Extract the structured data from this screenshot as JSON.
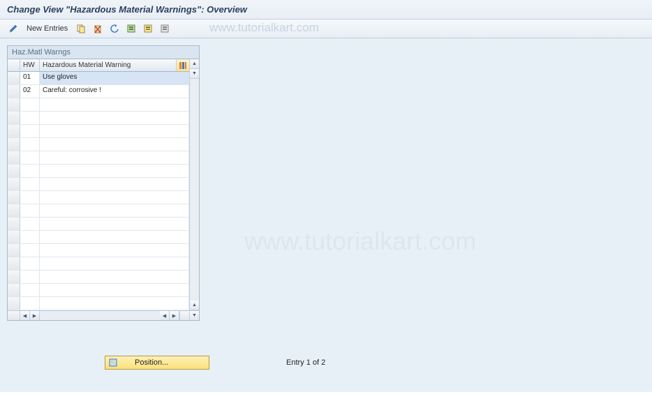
{
  "title": "Change View \"Hazardous Material Warnings\": Overview",
  "toolbar": {
    "new_entries": "New Entries"
  },
  "watermark": "www.tutorialkart.com",
  "panel": {
    "title": "Haz.Matl Warngs",
    "col_hw": "HW",
    "col_desc": "Hazardous Material Warning"
  },
  "rows": [
    {
      "hw": "01",
      "desc": "Use gloves",
      "selected": true
    },
    {
      "hw": "02",
      "desc": "Careful: corrosive !",
      "selected": false
    }
  ],
  "footer": {
    "position": "Position...",
    "entry": "Entry 1 of 2"
  }
}
